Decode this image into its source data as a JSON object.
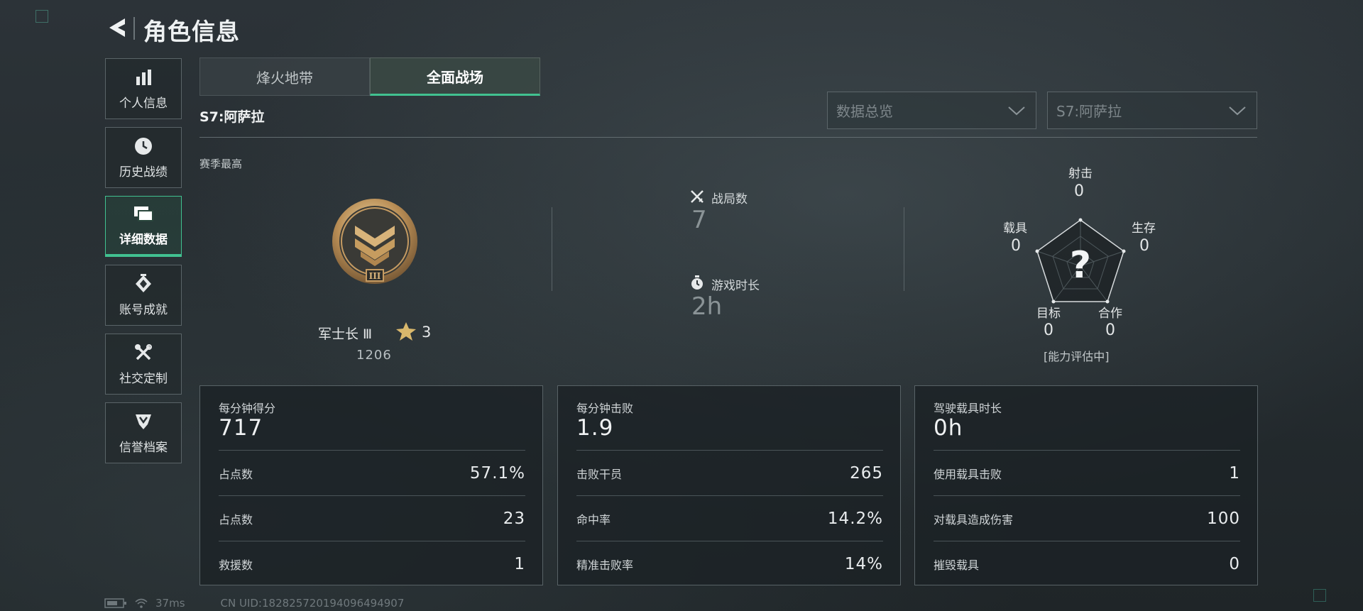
{
  "header": {
    "title": "角色信息",
    "back_icon": "back-arrow-icon"
  },
  "sidebar": {
    "items": [
      {
        "label": "个人信息",
        "icon": "bar-chart-icon",
        "active": false
      },
      {
        "label": "历史战绩",
        "icon": "clock-icon",
        "active": false
      },
      {
        "label": "详细数据",
        "icon": "folder-icon",
        "active": true
      },
      {
        "label": "账号成就",
        "icon": "achievement-icon",
        "active": false
      },
      {
        "label": "社交定制",
        "icon": "tools-icon",
        "active": false
      },
      {
        "label": "信誉档案",
        "icon": "shield-icon",
        "active": false
      }
    ]
  },
  "tabs": [
    {
      "label": "烽火地带",
      "active": false
    },
    {
      "label": "全面战场",
      "active": true
    }
  ],
  "season": {
    "label": "S7:阿萨拉"
  },
  "filters": {
    "data_type": {
      "value": "数据总览"
    },
    "season": {
      "value": "S7:阿萨拉"
    }
  },
  "section_label": "赛季最高",
  "rank": {
    "name": "军士长 Ⅲ",
    "stars": "3",
    "points": "1206",
    "emblem_roman": "III"
  },
  "summary": {
    "matches": {
      "label": "战局数",
      "value": "7",
      "icon": "crossed-swords-icon"
    },
    "playtime": {
      "label": "游戏时长",
      "value": "2h",
      "icon": "stopwatch-icon"
    }
  },
  "radar": {
    "center_symbol": "?",
    "status": "[能力评估中]",
    "axes": [
      {
        "label": "射击",
        "value": "0"
      },
      {
        "label": "生存",
        "value": "0"
      },
      {
        "label": "合作",
        "value": "0"
      },
      {
        "label": "目标",
        "value": "0"
      },
      {
        "label": "载具",
        "value": "0"
      }
    ]
  },
  "cards": [
    {
      "header": "每分钟得分",
      "value": "717",
      "rows": [
        {
          "label": "占点数",
          "value": "57.1%"
        },
        {
          "label": "占点数",
          "value": "23"
        },
        {
          "label": "救援数",
          "value": "1"
        }
      ]
    },
    {
      "header": "每分钟击败",
      "value": "1.9",
      "rows": [
        {
          "label": "击败干员",
          "value": "265"
        },
        {
          "label": "命中率",
          "value": "14.2%"
        },
        {
          "label": "精准击败率",
          "value": "14%"
        }
      ]
    },
    {
      "header": "驾驶载具时长",
      "value": "0h",
      "rows": [
        {
          "label": "使用载具击败",
          "value": "1"
        },
        {
          "label": "对载具造成伤害",
          "value": "100"
        },
        {
          "label": "摧毁载具",
          "value": "0"
        }
      ]
    }
  ],
  "footer": {
    "ping": "37ms",
    "uid": "CN UID:1828257201940964949​07"
  },
  "colors": {
    "accent": "#41c190",
    "gold": "#c9a66b"
  }
}
